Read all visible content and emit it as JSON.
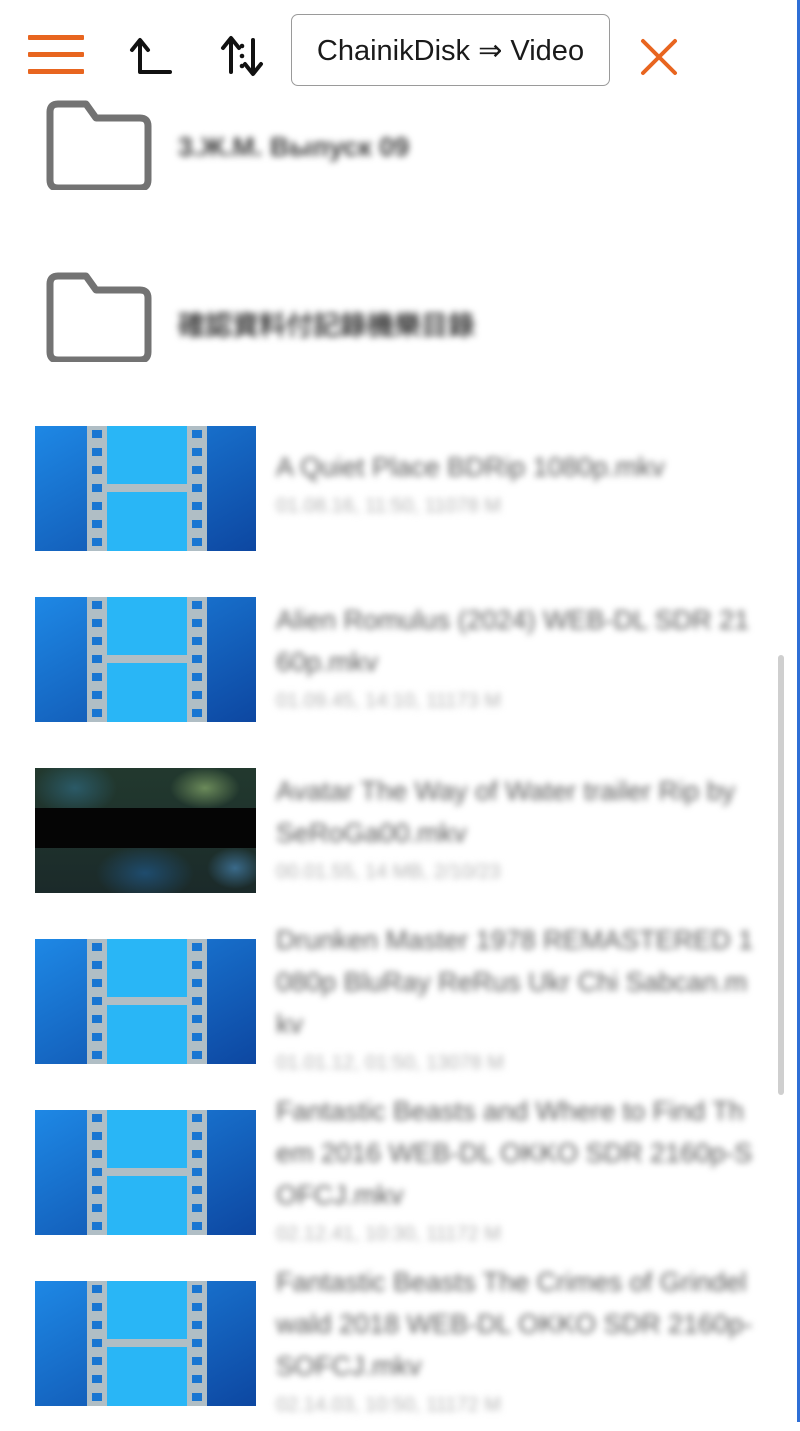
{
  "toolbar": {
    "path": "ChainikDisk ⇒ Video"
  },
  "folders": [
    {
      "name": "3.Ж.М. Выпуск 09"
    },
    {
      "name": "確認資料付記錄機樂目錄"
    }
  ],
  "files": [
    {
      "name": "A Quiet Place BDRip 1080p.mkv",
      "meta": "01.08.16, 11:50, 11078 M",
      "thumb": "video-icon"
    },
    {
      "name": "Alien Romulus (2024) WEB-DL SDR 2160p.mkv",
      "meta": "01.09.45, 14:10, 11173 M",
      "thumb": "video-icon"
    },
    {
      "name": "Avatar The Way of Water trailer Rip by SeRoGa00.mkv",
      "meta": "00.01.55, 14 MB, 2/10/23",
      "thumb": "avatar-frame"
    },
    {
      "name": "Drunken Master 1978 REMASTERED 1080p BluRay ReRus Ukr Chi Sabcan.mkv",
      "meta": "01.01.12, 01:50, 13078 M",
      "thumb": "video-icon"
    },
    {
      "name": "Fantastic Beasts and Where to Find Them 2016 WEB-DL OKKO SDR 2160p-SOFCJ.mkv",
      "meta": "02.12.41, 10:30, 11172 M",
      "thumb": "video-icon"
    },
    {
      "name": "Fantastic Beasts The Crimes of Grindelwald 2018 WEB-DL OKKO SDR 2160p-SOFCJ.mkv",
      "meta": "02.14.03, 10:50, 11172 M",
      "thumb": "video-icon"
    }
  ],
  "colors": {
    "accent": "#e8651f",
    "film_dark": "#1565c0",
    "film_light": "#29b6f6",
    "strip": "#b0bec5"
  }
}
